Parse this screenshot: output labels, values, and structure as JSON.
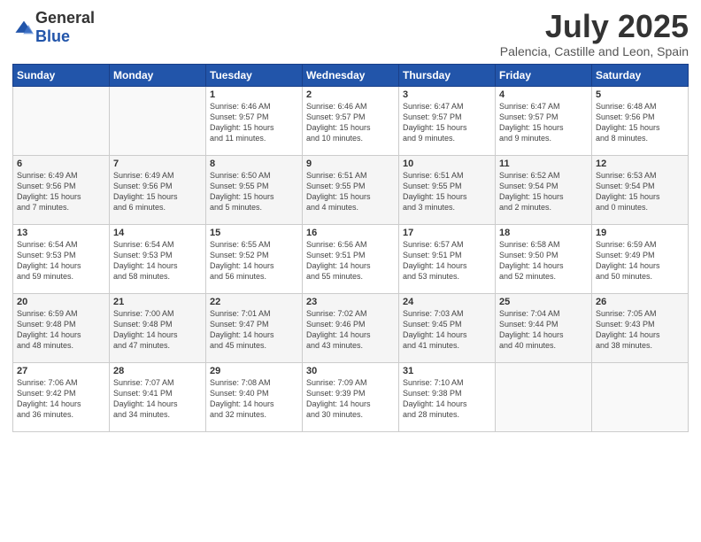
{
  "header": {
    "logo_general": "General",
    "logo_blue": "Blue",
    "month": "July 2025",
    "location": "Palencia, Castille and Leon, Spain"
  },
  "days_of_week": [
    "Sunday",
    "Monday",
    "Tuesday",
    "Wednesday",
    "Thursday",
    "Friday",
    "Saturday"
  ],
  "weeks": [
    [
      {
        "day": "",
        "info": ""
      },
      {
        "day": "",
        "info": ""
      },
      {
        "day": "1",
        "info": "Sunrise: 6:46 AM\nSunset: 9:57 PM\nDaylight: 15 hours\nand 11 minutes."
      },
      {
        "day": "2",
        "info": "Sunrise: 6:46 AM\nSunset: 9:57 PM\nDaylight: 15 hours\nand 10 minutes."
      },
      {
        "day": "3",
        "info": "Sunrise: 6:47 AM\nSunset: 9:57 PM\nDaylight: 15 hours\nand 9 minutes."
      },
      {
        "day": "4",
        "info": "Sunrise: 6:47 AM\nSunset: 9:57 PM\nDaylight: 15 hours\nand 9 minutes."
      },
      {
        "day": "5",
        "info": "Sunrise: 6:48 AM\nSunset: 9:56 PM\nDaylight: 15 hours\nand 8 minutes."
      }
    ],
    [
      {
        "day": "6",
        "info": "Sunrise: 6:49 AM\nSunset: 9:56 PM\nDaylight: 15 hours\nand 7 minutes."
      },
      {
        "day": "7",
        "info": "Sunrise: 6:49 AM\nSunset: 9:56 PM\nDaylight: 15 hours\nand 6 minutes."
      },
      {
        "day": "8",
        "info": "Sunrise: 6:50 AM\nSunset: 9:55 PM\nDaylight: 15 hours\nand 5 minutes."
      },
      {
        "day": "9",
        "info": "Sunrise: 6:51 AM\nSunset: 9:55 PM\nDaylight: 15 hours\nand 4 minutes."
      },
      {
        "day": "10",
        "info": "Sunrise: 6:51 AM\nSunset: 9:55 PM\nDaylight: 15 hours\nand 3 minutes."
      },
      {
        "day": "11",
        "info": "Sunrise: 6:52 AM\nSunset: 9:54 PM\nDaylight: 15 hours\nand 2 minutes."
      },
      {
        "day": "12",
        "info": "Sunrise: 6:53 AM\nSunset: 9:54 PM\nDaylight: 15 hours\nand 0 minutes."
      }
    ],
    [
      {
        "day": "13",
        "info": "Sunrise: 6:54 AM\nSunset: 9:53 PM\nDaylight: 14 hours\nand 59 minutes."
      },
      {
        "day": "14",
        "info": "Sunrise: 6:54 AM\nSunset: 9:53 PM\nDaylight: 14 hours\nand 58 minutes."
      },
      {
        "day": "15",
        "info": "Sunrise: 6:55 AM\nSunset: 9:52 PM\nDaylight: 14 hours\nand 56 minutes."
      },
      {
        "day": "16",
        "info": "Sunrise: 6:56 AM\nSunset: 9:51 PM\nDaylight: 14 hours\nand 55 minutes."
      },
      {
        "day": "17",
        "info": "Sunrise: 6:57 AM\nSunset: 9:51 PM\nDaylight: 14 hours\nand 53 minutes."
      },
      {
        "day": "18",
        "info": "Sunrise: 6:58 AM\nSunset: 9:50 PM\nDaylight: 14 hours\nand 52 minutes."
      },
      {
        "day": "19",
        "info": "Sunrise: 6:59 AM\nSunset: 9:49 PM\nDaylight: 14 hours\nand 50 minutes."
      }
    ],
    [
      {
        "day": "20",
        "info": "Sunrise: 6:59 AM\nSunset: 9:48 PM\nDaylight: 14 hours\nand 48 minutes."
      },
      {
        "day": "21",
        "info": "Sunrise: 7:00 AM\nSunset: 9:48 PM\nDaylight: 14 hours\nand 47 minutes."
      },
      {
        "day": "22",
        "info": "Sunrise: 7:01 AM\nSunset: 9:47 PM\nDaylight: 14 hours\nand 45 minutes."
      },
      {
        "day": "23",
        "info": "Sunrise: 7:02 AM\nSunset: 9:46 PM\nDaylight: 14 hours\nand 43 minutes."
      },
      {
        "day": "24",
        "info": "Sunrise: 7:03 AM\nSunset: 9:45 PM\nDaylight: 14 hours\nand 41 minutes."
      },
      {
        "day": "25",
        "info": "Sunrise: 7:04 AM\nSunset: 9:44 PM\nDaylight: 14 hours\nand 40 minutes."
      },
      {
        "day": "26",
        "info": "Sunrise: 7:05 AM\nSunset: 9:43 PM\nDaylight: 14 hours\nand 38 minutes."
      }
    ],
    [
      {
        "day": "27",
        "info": "Sunrise: 7:06 AM\nSunset: 9:42 PM\nDaylight: 14 hours\nand 36 minutes."
      },
      {
        "day": "28",
        "info": "Sunrise: 7:07 AM\nSunset: 9:41 PM\nDaylight: 14 hours\nand 34 minutes."
      },
      {
        "day": "29",
        "info": "Sunrise: 7:08 AM\nSunset: 9:40 PM\nDaylight: 14 hours\nand 32 minutes."
      },
      {
        "day": "30",
        "info": "Sunrise: 7:09 AM\nSunset: 9:39 PM\nDaylight: 14 hours\nand 30 minutes."
      },
      {
        "day": "31",
        "info": "Sunrise: 7:10 AM\nSunset: 9:38 PM\nDaylight: 14 hours\nand 28 minutes."
      },
      {
        "day": "",
        "info": ""
      },
      {
        "day": "",
        "info": ""
      }
    ]
  ]
}
